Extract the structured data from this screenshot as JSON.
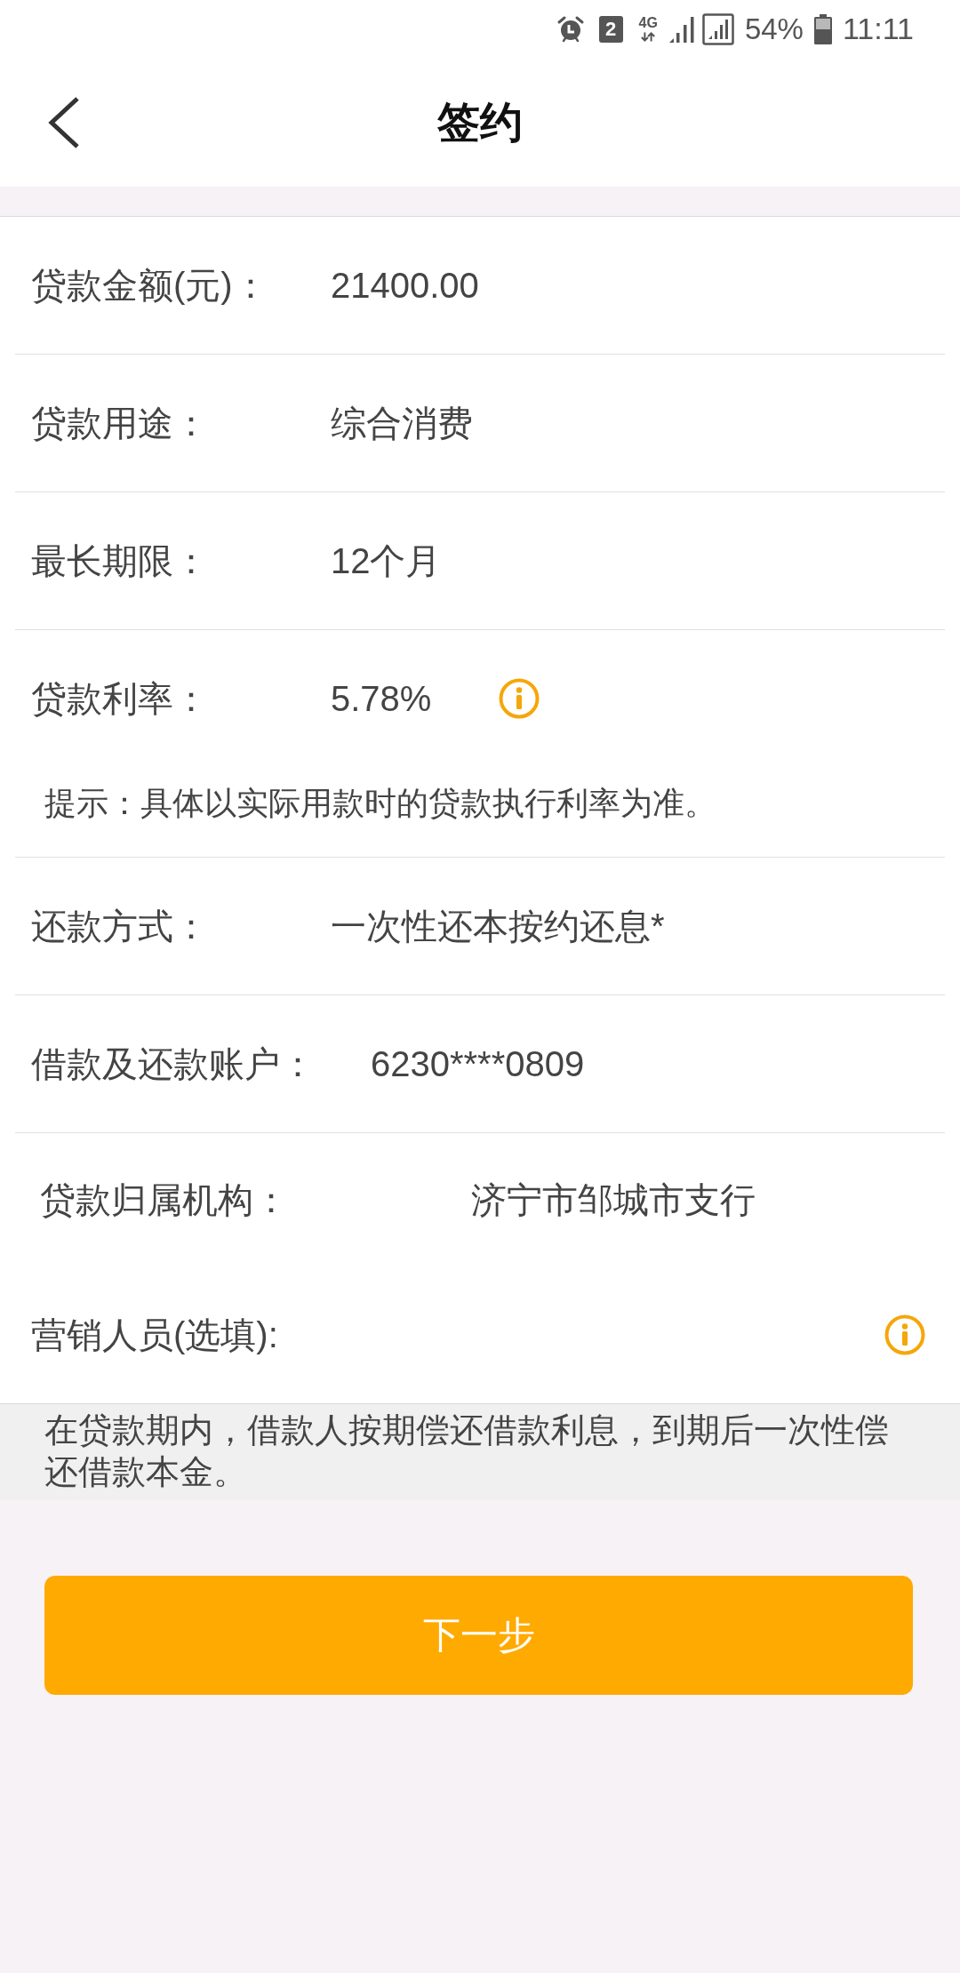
{
  "status_bar": {
    "sim_slot": "2",
    "network": "4G",
    "battery": "54%",
    "time": "11:11"
  },
  "header": {
    "title": "签约"
  },
  "fields": [
    {
      "kind": "field",
      "label": "贷款金额(元)：",
      "value": "21400.00"
    },
    {
      "kind": "field",
      "label": "贷款用途：",
      "value": "综合消费"
    },
    {
      "kind": "field",
      "label": "最长期限：",
      "value": "12个月"
    },
    {
      "kind": "field",
      "label": "贷款利率：",
      "value": "5.78%",
      "info": true,
      "hint": "提示：具体以实际用款时的贷款执行利率为准。"
    },
    {
      "kind": "field",
      "label": "还款方式：",
      "value": "一次性还本按约还息*"
    },
    {
      "kind": "account",
      "label": "借款及还款账户：",
      "value": "6230****0809"
    },
    {
      "kind": "org",
      "label": "贷款归属机构：",
      "value": "济宁市邹城市支行"
    },
    {
      "kind": "optional",
      "label": "营销人员(选填):",
      "info": true
    }
  ],
  "note": "在贷款期内，借款人按期偿还借款利息，到期后一次性偿还借款本金。",
  "next_button": "下一步"
}
